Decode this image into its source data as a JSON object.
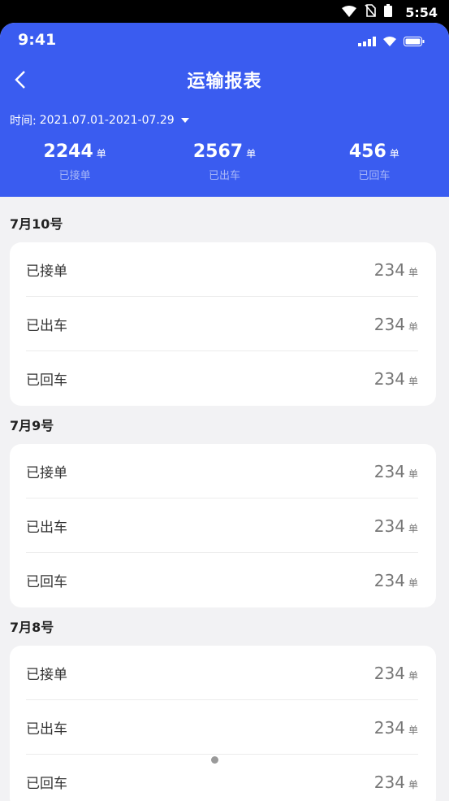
{
  "os_status": {
    "time": "5:54"
  },
  "header": {
    "inner_time": "9:41",
    "title": "运输报表",
    "date_label": "时间:",
    "date_range": "2021.07.01-2021-07.29",
    "stats": [
      {
        "value": "2244",
        "unit": "单",
        "label": "已接单"
      },
      {
        "value": "2567",
        "unit": "单",
        "label": "已出车"
      },
      {
        "value": "456",
        "unit": "单",
        "label": "已回车"
      }
    ]
  },
  "sections": [
    {
      "date": "7月10号",
      "rows": [
        {
          "label": "已接单",
          "value": "234",
          "unit": "单"
        },
        {
          "label": "已出车",
          "value": "234",
          "unit": "单"
        },
        {
          "label": "已回车",
          "value": "234",
          "unit": "单"
        }
      ]
    },
    {
      "date": "7月9号",
      "rows": [
        {
          "label": "已接单",
          "value": "234",
          "unit": "单"
        },
        {
          "label": "已出车",
          "value": "234",
          "unit": "单"
        },
        {
          "label": "已回车",
          "value": "234",
          "unit": "单"
        }
      ]
    },
    {
      "date": "7月8号",
      "rows": [
        {
          "label": "已接单",
          "value": "234",
          "unit": "单"
        },
        {
          "label": "已出车",
          "value": "234",
          "unit": "单"
        },
        {
          "label": "已回车",
          "value": "234",
          "unit": "单"
        }
      ]
    }
  ]
}
